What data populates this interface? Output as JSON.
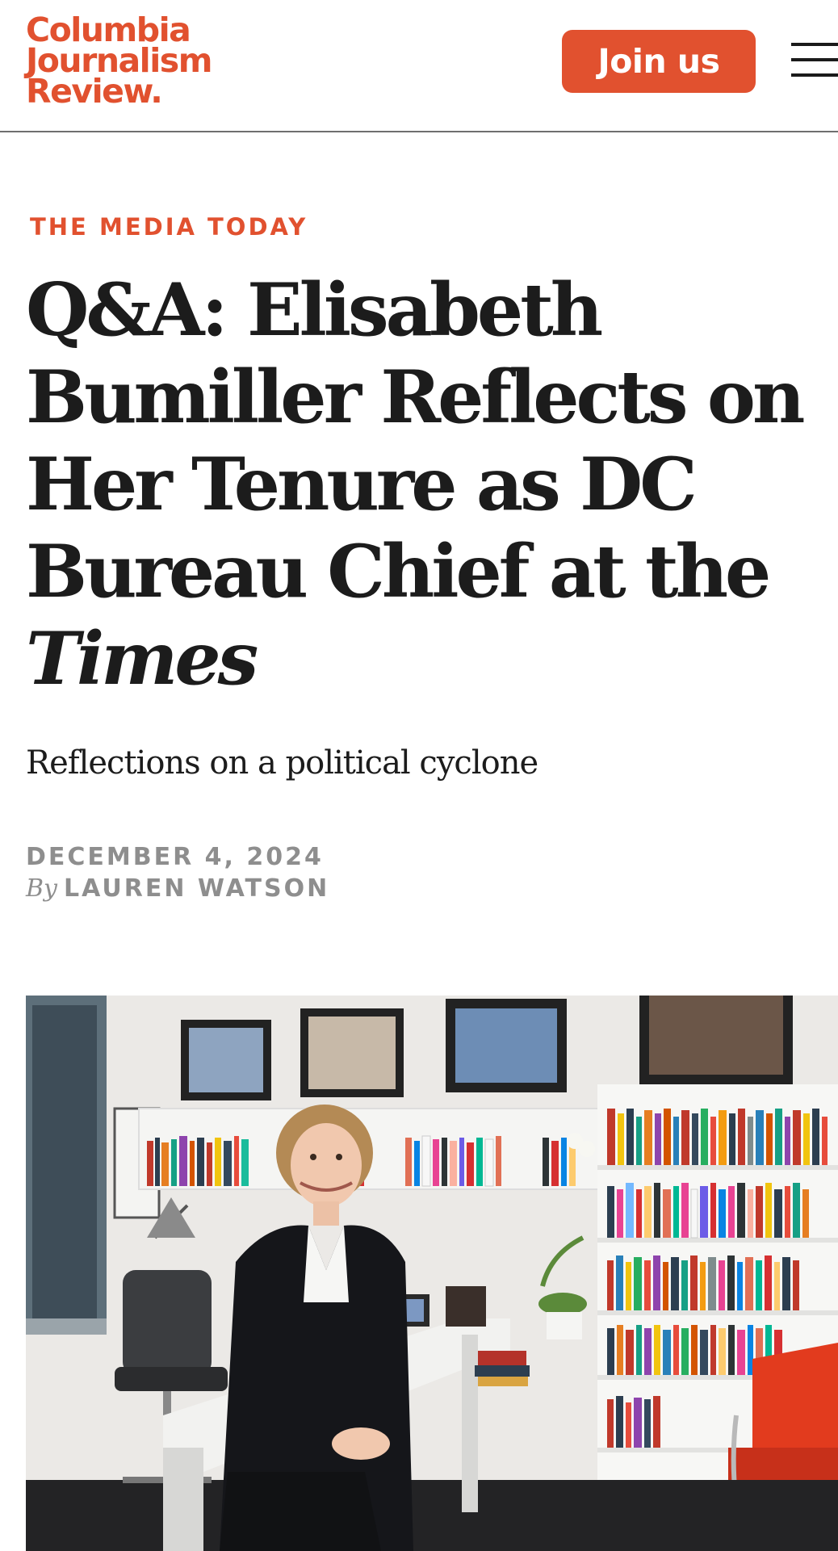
{
  "header": {
    "logo_lines": [
      "Columbia",
      "Journalism",
      "Review."
    ],
    "join_label": "Join us"
  },
  "article": {
    "kicker": "THE MEDIA TODAY",
    "headline_lines": [
      "Q&A: Elisabeth",
      "Bumiller Reflects on",
      "Her Tenure as DC",
      "Bureau Chief at the"
    ],
    "headline_italic": "Times",
    "dek": "Reflections on a political cyclone",
    "date": "DECEMBER 4, 2024",
    "by_prefix": "By",
    "author": "LAUREN WATSON"
  },
  "colors": {
    "accent": "#e1512f",
    "meta_gray": "#8e8e8e",
    "text": "#1c1c1c"
  },
  "icons": {
    "menu": "hamburger-menu-icon"
  }
}
